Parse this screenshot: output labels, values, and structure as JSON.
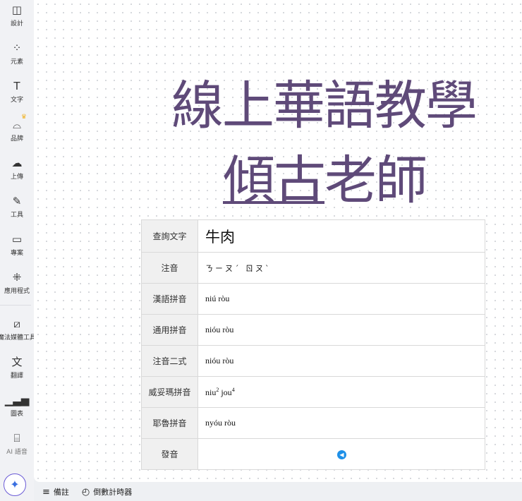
{
  "sidebar": {
    "items": [
      {
        "label": "設計",
        "icon": "layout-icon"
      },
      {
        "label": "元素",
        "icon": "shapes-icon"
      },
      {
        "label": "文字",
        "icon": "text-icon"
      },
      {
        "label": "品牌",
        "icon": "brand-icon"
      },
      {
        "label": "上傳",
        "icon": "cloud-upload-icon"
      },
      {
        "label": "工具",
        "icon": "pen-icon"
      },
      {
        "label": "專案",
        "icon": "folder-icon"
      },
      {
        "label": "應用程式",
        "icon": "apps-icon"
      },
      {
        "label": "魔法媒體工具",
        "icon": "magic-media-icon"
      },
      {
        "label": "翻譯",
        "icon": "translate-icon"
      },
      {
        "label": "圖表",
        "icon": "chart-icon"
      },
      {
        "label": "AI 語音",
        "icon": "ai-voice-icon"
      }
    ]
  },
  "canvas": {
    "title_line1": "線上華語教學",
    "title_line2_underlined": "傾古",
    "title_line2_rest": "老師",
    "title_color": "#5f4a79"
  },
  "table": {
    "rows": [
      {
        "label": "查詢文字",
        "value": "牛肉"
      },
      {
        "label": "注音",
        "value": "ㄋㄧㄡˊ ㄖㄡˋ"
      },
      {
        "label": "漢語拼音",
        "value": "niú ròu"
      },
      {
        "label": "通用拼音",
        "value": "nióu ròu"
      },
      {
        "label": "注音二式",
        "value": "nióu ròu"
      },
      {
        "label": "威妥瑪拼音",
        "value_a": "niu",
        "sup_a": "2",
        "value_b": " jou",
        "sup_b": "4"
      },
      {
        "label": "耶魯拼音",
        "value": "nyóu ròu"
      },
      {
        "label": "發音",
        "icon": "speaker-icon"
      }
    ]
  },
  "bottom": {
    "notes": "備註",
    "timer": "倒數計時器"
  }
}
